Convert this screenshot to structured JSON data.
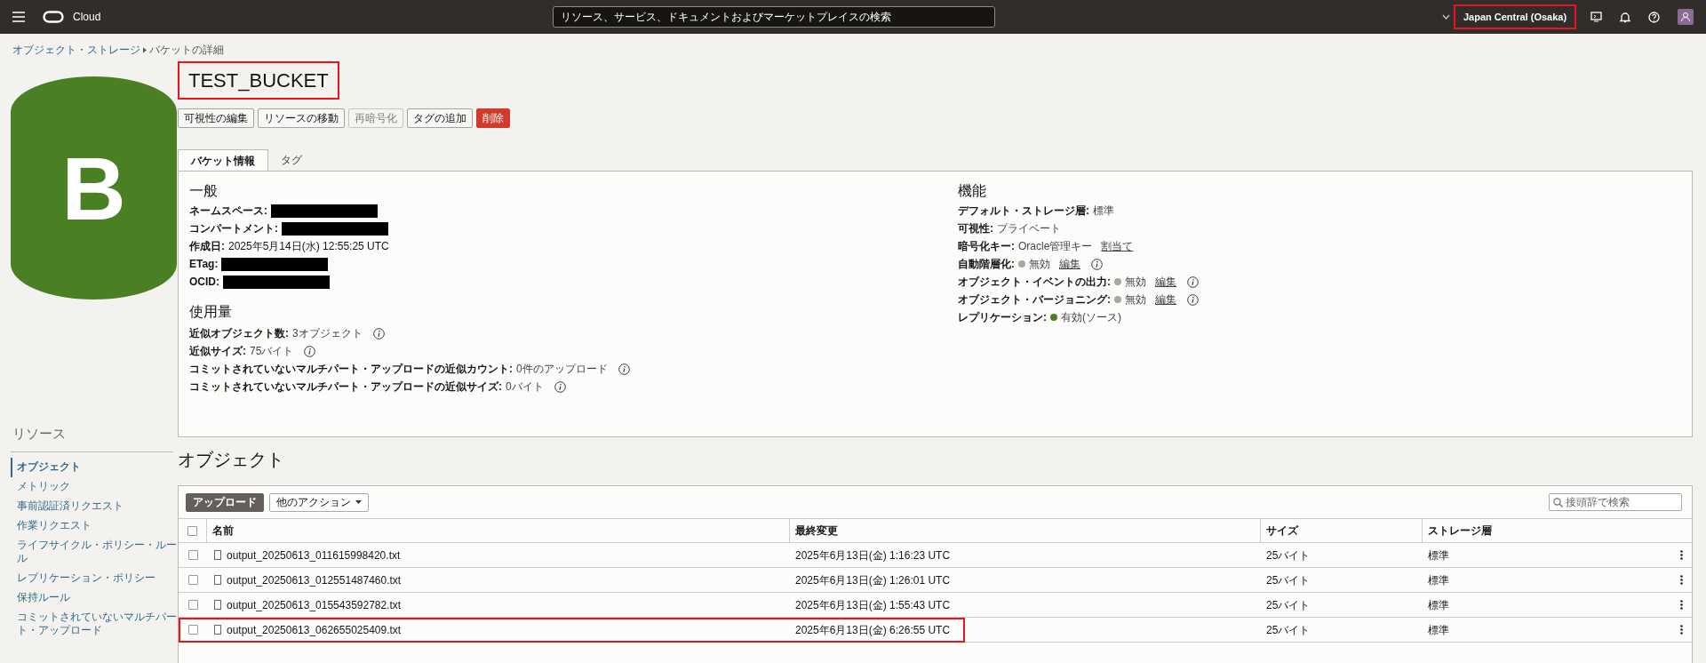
{
  "top_bar": {
    "brand": "Cloud",
    "search": {
      "placeholder": "リソース、サービス、ドキュメントおよびマーケットプレイスの検索"
    },
    "region": {
      "label": "Japan Central (Osaka)",
      "highlighted": true
    }
  },
  "breadcrumb": [
    {
      "label": "オブジェクト・ストレージ",
      "kind": "link"
    },
    {
      "label": "バケットの詳細",
      "kind": "current"
    }
  ],
  "bucket_icon": {
    "letter": "B"
  },
  "title": {
    "text": "TEST_BUCKET",
    "highlighted": true
  },
  "actions": [
    {
      "label": "可視性の編集",
      "kind": "default",
      "disabled": false
    },
    {
      "label": "リソースの移動",
      "kind": "default",
      "disabled": false
    },
    {
      "label": "再暗号化",
      "kind": "default",
      "disabled": true
    },
    {
      "label": "タグの追加",
      "kind": "default",
      "disabled": false
    },
    {
      "label": "削除",
      "kind": "danger",
      "disabled": false
    }
  ],
  "tabs": [
    {
      "label": "バケット情報",
      "selected": true
    },
    {
      "label": "タグ",
      "selected": false
    }
  ],
  "general": {
    "heading": "一般",
    "fields": [
      {
        "label": "ネームスペース:",
        "redacted": true
      },
      {
        "label": "コンパートメント:",
        "redacted": true
      },
      {
        "label": "作成日:",
        "value": "2025年5月14日(水) 12:55:25 UTC"
      },
      {
        "label": "ETag:",
        "redacted": true
      },
      {
        "label": "OCID:",
        "redacted": true
      }
    ]
  },
  "usage": {
    "heading": "使用量",
    "fields": [
      {
        "label": "近似オブジェクト数:",
        "value": "3オブジェクト",
        "info": true
      },
      {
        "label": "近似サイズ:",
        "value": "75バイト",
        "info": true
      },
      {
        "label": "コミットされていないマルチパート・アップロードの近似カウント:",
        "value": "0件のアップロード",
        "info": true
      },
      {
        "label": "コミットされていないマルチパート・アップロードの近似サイズ:",
        "value": "0バイト",
        "info": true
      }
    ]
  },
  "features": {
    "heading": "機能",
    "fields": [
      {
        "label": "デフォルト・ストレージ層:",
        "value": "標準"
      },
      {
        "label": "可視性:",
        "value": "プライベート"
      },
      {
        "label": "暗号化キー:",
        "value": "Oracle管理キー",
        "link": "割当て"
      },
      {
        "label": "自動階層化:",
        "color": "#a9a5a0",
        "value": "無効",
        "link": "編集",
        "info": true
      },
      {
        "label": "オブジェクト・イベントの出力:",
        "color": "#a9a5a0",
        "value": "無効",
        "link": "編集",
        "info": true
      },
      {
        "label": "オブジェクト・バージョニング:",
        "color": "#a9a5a0",
        "value": "無効",
        "link": "編集",
        "info": true
      },
      {
        "label": "レプリケーション:",
        "color": "#4b7f24",
        "value": "有効(ソース)"
      }
    ]
  },
  "sidebar": {
    "heading": "リソース",
    "items": [
      {
        "label": "オブジェクト",
        "selected": true
      },
      {
        "label": "メトリック",
        "selected": false
      },
      {
        "label": "事前認証済リクエスト",
        "selected": false
      },
      {
        "label": "作業リクエスト",
        "selected": false
      },
      {
        "label": "ライフサイクル・ポリシー・ルール",
        "selected": false
      },
      {
        "label": "レプリケーション・ポリシー",
        "selected": false
      },
      {
        "label": "保持ルール",
        "selected": false
      },
      {
        "label": "コミットされていないマルチパート・アップロード",
        "selected": false
      }
    ]
  },
  "objects": {
    "heading": "オブジェクト",
    "toolbar": [
      {
        "label": "アップロード",
        "kind": "primary"
      },
      {
        "label": "他のアクション",
        "kind": "dropdown"
      }
    ],
    "search": {
      "placeholder": "接頭辞で検索"
    },
    "table": {
      "columns": [
        "名前",
        "最終変更",
        "サイズ",
        "ストレージ層"
      ],
      "all_checked": false,
      "rows": [
        {
          "name": "output_20250613_011615998420.txt",
          "modified": "2025年6月13日(金) 1:16:23 UTC",
          "size": "25バイト",
          "tier": "標準",
          "checked": false,
          "highlighted": false
        },
        {
          "name": "output_20250613_012551487460.txt",
          "modified": "2025年6月13日(金) 1:26:01 UTC",
          "size": "25バイト",
          "tier": "標準",
          "checked": false,
          "highlighted": false
        },
        {
          "name": "output_20250613_015543592782.txt",
          "modified": "2025年6月13日(金) 1:55:43 UTC",
          "size": "25バイト",
          "tier": "標準",
          "checked": false,
          "highlighted": false
        },
        {
          "name": "output_20250613_062655025409.txt",
          "modified": "2025年6月13日(金) 6:26:55 UTC",
          "size": "25バイト",
          "tier": "標準",
          "checked": false,
          "highlighted": true
        }
      ]
    }
  }
}
